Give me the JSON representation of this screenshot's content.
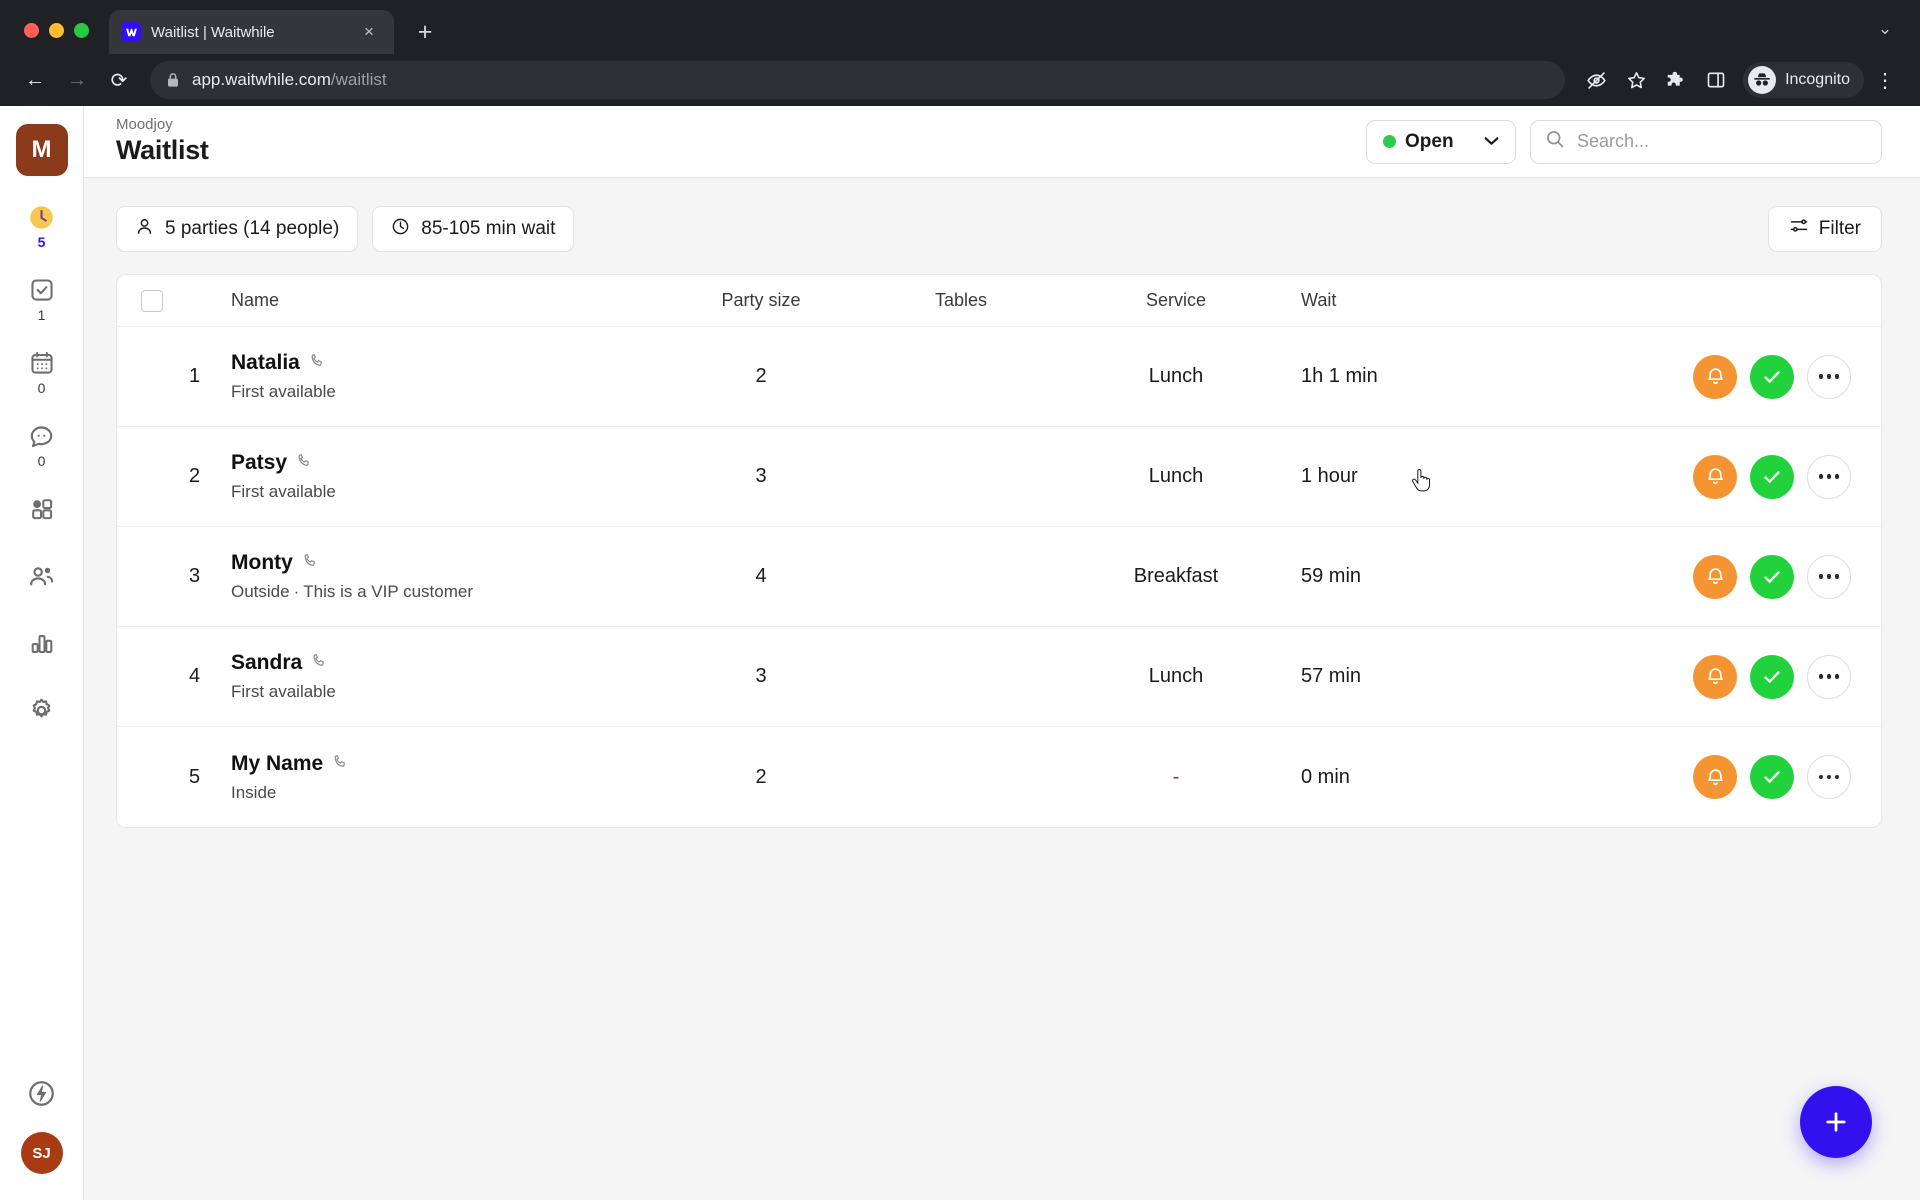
{
  "browser": {
    "tab": {
      "title": "Waitlist | Waitwhile",
      "favicon": "waitwhile-logo-icon",
      "close": "×"
    },
    "new_tab_label": "+",
    "tab_list_chevron": "⌄",
    "nav": {
      "back": "←",
      "forward": "→",
      "reload": "⟳"
    },
    "omnibox": {
      "lock": "lock-icon",
      "domain": "app.waitwhile.com",
      "path": "/waitlist"
    },
    "toolbar_icons": [
      "eye-off-icon",
      "star-icon",
      "extensions-puzzle-icon",
      "side-panel-icon"
    ],
    "profile": {
      "label": "Incognito",
      "avatar": "incognito-hat-icon"
    },
    "menu": "⋮"
  },
  "sidebar": {
    "logo": "M",
    "items": [
      {
        "name": "waitlist",
        "icon": "clock-icon",
        "count": "5",
        "active": true
      },
      {
        "name": "checked-in",
        "icon": "check-square-icon",
        "count": "1",
        "active": false
      },
      {
        "name": "bookings",
        "icon": "calendar-icon",
        "count": "0",
        "active": false
      },
      {
        "name": "messages",
        "icon": "chat-bubble-icon",
        "count": "0",
        "active": false
      },
      {
        "name": "apps",
        "icon": "grid-apps-icon",
        "count": "",
        "active": false
      },
      {
        "name": "customers",
        "icon": "people-icon",
        "count": "",
        "active": false
      },
      {
        "name": "analytics",
        "icon": "bar-chart-icon",
        "count": "",
        "active": false
      },
      {
        "name": "settings",
        "icon": "gear-icon",
        "count": "",
        "active": false
      }
    ],
    "bottom": {
      "power_icon": "lightning-bolt-icon",
      "avatar_initials": "SJ"
    }
  },
  "header": {
    "org": "Moodjoy",
    "title": "Waitlist",
    "status": {
      "label": "Open",
      "dot_color": "#2ecc4a",
      "chevron": "⌄"
    },
    "search": {
      "placeholder": "Search...",
      "value": "",
      "icon": "search-icon"
    }
  },
  "toolbar": {
    "parties_chip": {
      "icon": "person-icon",
      "label": "5 parties (14 people)"
    },
    "wait_chip": {
      "icon": "clock-icon",
      "label": "85-105 min wait"
    },
    "filter": {
      "icon": "filter-sliders-icon",
      "label": "Filter"
    }
  },
  "table": {
    "columns": [
      "Name",
      "Party size",
      "Tables",
      "Service",
      "Wait"
    ],
    "rows": [
      {
        "position": "1",
        "name": "Natalia",
        "contact_icon": "phone-icon",
        "note": "First available",
        "note2": "",
        "party_size": "2",
        "tables": "",
        "service": "Lunch",
        "wait": "1h 1 min"
      },
      {
        "position": "2",
        "name": "Patsy",
        "contact_icon": "phone-icon",
        "note": "First available",
        "note2": "",
        "party_size": "3",
        "tables": "",
        "service": "Lunch",
        "wait": "1 hour"
      },
      {
        "position": "3",
        "name": "Monty",
        "contact_icon": "phone-icon",
        "note": "Outside",
        "note2": "This is a VIP customer",
        "party_size": "4",
        "tables": "",
        "service": "Breakfast",
        "wait": "59 min"
      },
      {
        "position": "4",
        "name": "Sandra",
        "contact_icon": "phone-icon",
        "note": "First available",
        "note2": "",
        "party_size": "3",
        "tables": "",
        "service": "Lunch",
        "wait": "57 min"
      },
      {
        "position": "5",
        "name": "My Name",
        "contact_icon": "phone-icon",
        "note": "Inside",
        "note2": "",
        "party_size": "2",
        "tables": "",
        "service": "-",
        "wait": "0 min"
      }
    ],
    "row_actions": {
      "notify": {
        "icon": "bell-icon",
        "color": "#f59432"
      },
      "serve": {
        "icon": "check-icon",
        "color": "#22d23c"
      },
      "more": {
        "icon": "more-dots-icon"
      }
    }
  },
  "fab": {
    "icon": "plus-icon",
    "color": "#3311ee"
  }
}
